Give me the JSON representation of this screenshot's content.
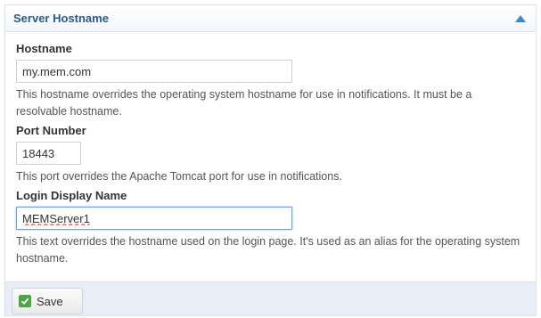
{
  "panel": {
    "title": "Server Hostname",
    "collapse_icon": "chevron-up-icon",
    "accent_color": "#2a5a8a"
  },
  "fields": {
    "hostname": {
      "label": "Hostname",
      "value": "my.mem.com",
      "help": "This hostname overrides the operating system hostname for use in notifications. It must be a resolvable hostname."
    },
    "port": {
      "label": "Port Number",
      "value": "18443",
      "help": "This port overrides the Apache Tomcat port for use in notifications."
    },
    "login_display_name": {
      "label": "Login Display Name",
      "value": "MEMServer1",
      "help": "This text overrides the hostname used on the login page. It's used as an alias for the operating system hostname."
    }
  },
  "footer": {
    "save_label": "Save",
    "save_icon": "check-icon",
    "save_icon_color": "#4aa843"
  }
}
